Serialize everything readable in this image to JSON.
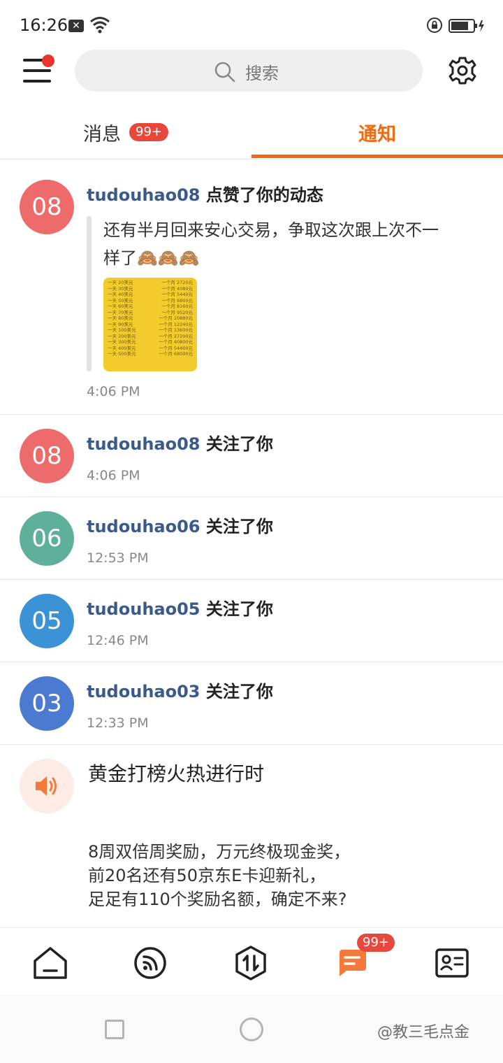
{
  "status_bar": {
    "time": "16:26"
  },
  "header": {
    "search_placeholder": "搜索"
  },
  "tabs": [
    {
      "label": "消息",
      "badge": "99+"
    },
    {
      "label": "通知"
    }
  ],
  "notifications": [
    {
      "avatar": "08",
      "avatar_color": "#ee6b6b",
      "user": "tudouhao08",
      "action": "点赞了你的动态",
      "quote_lines": [
        "还有半月回来安心交易，争取这次跟上次不一",
        "样了🙈🙈🙈"
      ],
      "image_rows": [
        [
          "一天 20美元",
          "一个月 2720元"
        ],
        [
          "一天 30美元",
          "一个月 4080元"
        ],
        [
          "一天 40美元",
          "一个月 5440元"
        ],
        [
          "一天 50美元",
          "一个月 6800元"
        ],
        [
          "一天 60美元",
          "一个月 8160元"
        ],
        [
          "一天 70美元",
          "一个月 9520元"
        ],
        [
          "一天 80美元",
          "一个月 10880元"
        ],
        [
          "一天 90美元",
          "一个月 12240元"
        ],
        [
          "一天 100美元",
          "一个月 13600元"
        ],
        [
          "一天 200美元",
          "一个月 27200元"
        ],
        [
          "一天 300美元",
          "一个月 40800元"
        ],
        [
          "一天 400美元",
          "一个月 54400元"
        ],
        [
          "一天 500美元",
          "一个月 68000元"
        ]
      ],
      "time": "4:06 PM"
    },
    {
      "avatar": "08",
      "avatar_color": "#ee6b6b",
      "user": "tudouhao08",
      "action": "关注了你",
      "time": "4:06 PM"
    },
    {
      "avatar": "06",
      "avatar_color": "#5fb09a",
      "user": "tudouhao06",
      "action": "关注了你",
      "time": "12:53 PM"
    },
    {
      "avatar": "05",
      "avatar_color": "#3b93d6",
      "user": "tudouhao05",
      "action": "关注了你",
      "time": "12:46 PM"
    },
    {
      "avatar": "03",
      "avatar_color": "#4a7bd0",
      "user": "tudouhao03",
      "action": "关注了你",
      "time": "12:33 PM"
    }
  ],
  "announcement": {
    "title": "黄金打榜火热进行时",
    "body_lines": [
      "8周双倍周奖励，万元终极现金奖，",
      "前20名还有50京东E卡迎新礼，",
      "足足有110个奖励名额，确定不来?"
    ]
  },
  "bottom_nav": {
    "items": [
      "home-icon",
      "feed-icon",
      "trade-icon",
      "chat-icon",
      "contact-card-icon"
    ],
    "active_index": 3,
    "chat_badge": "99+",
    "accent_color": "#f26a10"
  },
  "system_nav": {
    "watermark": "@教三毛点金"
  }
}
